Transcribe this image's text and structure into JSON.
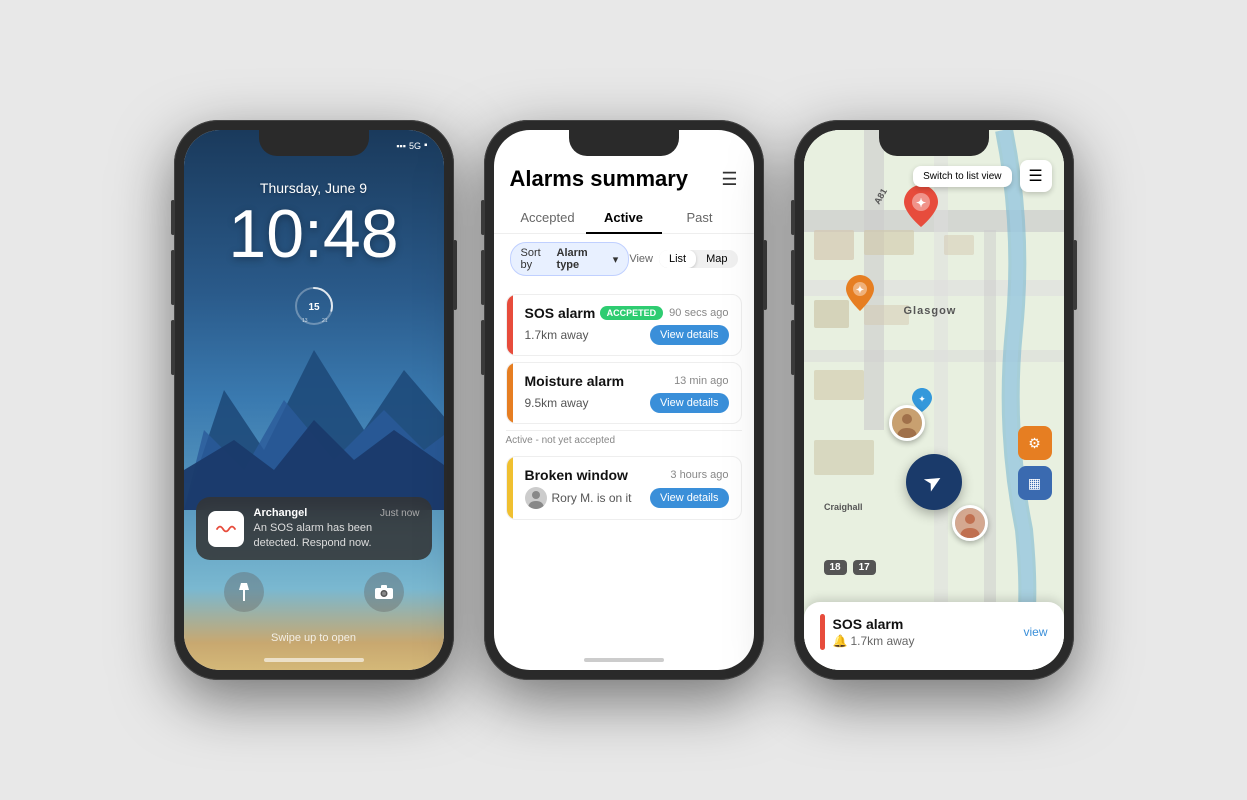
{
  "phone1": {
    "date": "Thursday, June 9",
    "time": "10:48",
    "notification": {
      "app": "Archangel",
      "time": "Just now",
      "text": "An SOS alarm has been detected. Respond now."
    },
    "swipe_hint": "Swipe up to open",
    "status_5g": "5G"
  },
  "phone2": {
    "title": "Alarms summary",
    "menu_icon": "☰",
    "tabs": [
      {
        "label": "Accepted",
        "active": false
      },
      {
        "label": "Active",
        "active": true
      },
      {
        "label": "Past",
        "active": false
      }
    ],
    "sort_label": "Sort by",
    "sort_value": "Alarm type",
    "view_label": "View",
    "view_options": [
      "List",
      "Map"
    ],
    "active_view": "List",
    "alarms": [
      {
        "type": "SOS alarm",
        "color": "#e74c3c",
        "badge": "ACCPETED",
        "time": "90 secs ago",
        "distance": "1.7km away",
        "has_details": true
      },
      {
        "type": "Moisture alarm",
        "color": "#e67e22",
        "badge": null,
        "time": "13 min ago",
        "distance": "9.5km away",
        "has_details": true
      }
    ],
    "section_divider": "Active - not yet accepted",
    "pending_alarm": {
      "type": "Broken window",
      "color": "#f0c030",
      "time": "3 hours ago",
      "assigned": "Rory M. is on it",
      "has_details": true
    }
  },
  "phone3": {
    "switch_view_label": "Switch to list view",
    "menu_icon": "☰",
    "bottom_card": {
      "alarm_name": "SOS alarm",
      "distance": "1.7km away",
      "view_link": "view"
    },
    "nav_arrow": "➤",
    "alarm_icon": "🔔"
  }
}
